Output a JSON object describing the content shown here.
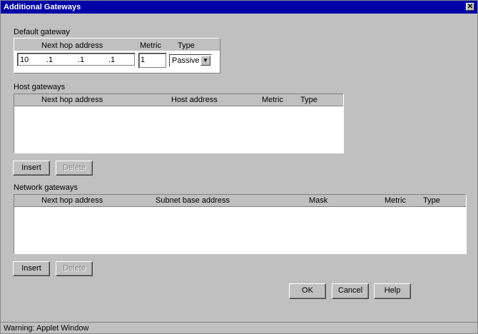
{
  "window": {
    "title": "Additional Gateways"
  },
  "default_gateway": {
    "label": "Default gateway",
    "headers": {
      "next_hop": "Next hop address",
      "metric": "Metric",
      "type": "Type"
    },
    "ip": [
      "10",
      ".1",
      ".1",
      ".1"
    ],
    "metric": "1",
    "type": "Passive"
  },
  "host_gateways": {
    "label": "Host gateways",
    "headers": {
      "next_hop": "Next hop address",
      "host": "Host address",
      "metric": "Metric",
      "type": "Type"
    },
    "insert": "Insert",
    "delete": "Delete"
  },
  "network_gateways": {
    "label": "Network gateways",
    "headers": {
      "next_hop": "Next hop address",
      "subnet": "Subnet base address",
      "mask": "Mask",
      "metric": "Metric",
      "type": "Type"
    },
    "insert": "Insert",
    "delete": "Delete"
  },
  "dialog_buttons": {
    "ok": "OK",
    "cancel": "Cancel",
    "help": "Help"
  },
  "status": "Warning: Applet Window"
}
